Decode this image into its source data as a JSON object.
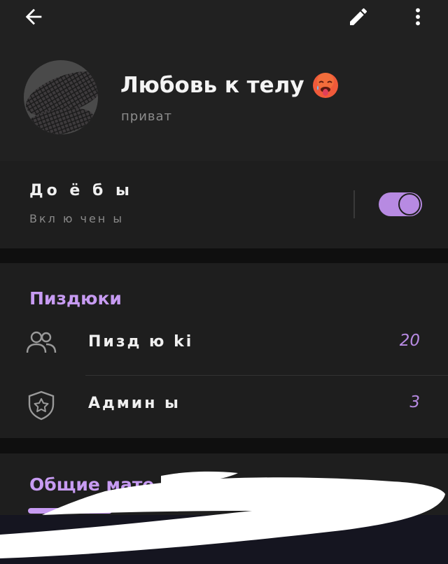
{
  "topbar": {
    "back_icon": "arrow-left-icon",
    "edit_icon": "pencil-icon",
    "more_icon": "more-vertical-icon"
  },
  "group": {
    "title": "Любовь к телу",
    "emoji_icon": "hot-face-emoji",
    "subtitle": "приват"
  },
  "notifications": {
    "title": "До ё б ы",
    "status": "Вкл ю чен ы",
    "toggle_on": true,
    "accent": "#b78ae2"
  },
  "members": {
    "section_title": "Пиздюки",
    "rows": [
      {
        "label": "Пизд ю ki",
        "count": "20",
        "icon": "people-icon"
      },
      {
        "label": "Админ ы",
        "count": "3",
        "icon": "shield-star-icon"
      }
    ]
  },
  "media": {
    "section_title": "Общие мате    лы"
  },
  "colors": {
    "accent": "#c79bf2",
    "panel": "#1e1e1e",
    "header": "#212121",
    "background": "#0f0f0f"
  }
}
